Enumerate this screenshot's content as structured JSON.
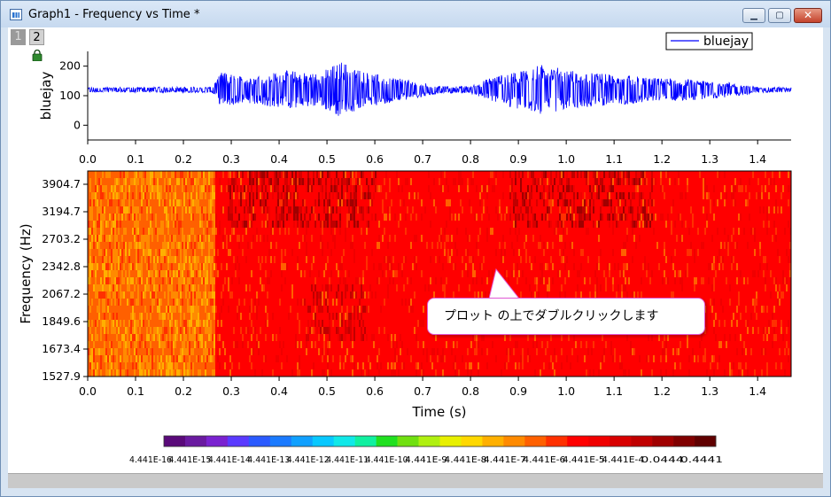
{
  "window": {
    "title": "Graph1 - Frequency vs Time *",
    "minimize_glyph": "▁",
    "maximize_glyph": "▢",
    "close_glyph": "✕"
  },
  "layers": [
    "1",
    "2"
  ],
  "legend": {
    "label": "bluejay",
    "color": "#0000ff"
  },
  "callout": {
    "text": "プロット の上でダブルクリックします"
  },
  "chart_data": [
    {
      "type": "line",
      "series": [
        {
          "name": "bluejay",
          "color": "#0000ff"
        }
      ],
      "ylabel": "bluejay",
      "xlabel": "",
      "x_ticks": [
        "0.0",
        "0.1",
        "0.2",
        "0.3",
        "0.4",
        "0.5",
        "0.6",
        "0.7",
        "0.8",
        "0.9",
        "1.0",
        "1.1",
        "1.2",
        "1.3",
        "1.4"
      ],
      "y_ticks": [
        "0",
        "100",
        "200"
      ],
      "xlim": [
        0,
        1.47
      ],
      "ylim": [
        -50,
        250
      ],
      "baseline": 120,
      "envelope": [
        {
          "x": 0.0,
          "amp": 8
        },
        {
          "x": 0.26,
          "amp": 10
        },
        {
          "x": 0.28,
          "amp": 60
        },
        {
          "x": 0.32,
          "amp": 45
        },
        {
          "x": 0.42,
          "amp": 65
        },
        {
          "x": 0.48,
          "amp": 55
        },
        {
          "x": 0.53,
          "amp": 95
        },
        {
          "x": 0.58,
          "amp": 60
        },
        {
          "x": 0.66,
          "amp": 35
        },
        {
          "x": 0.74,
          "amp": 12
        },
        {
          "x": 0.8,
          "amp": 12
        },
        {
          "x": 0.84,
          "amp": 40
        },
        {
          "x": 0.95,
          "amp": 85
        },
        {
          "x": 1.03,
          "amp": 60
        },
        {
          "x": 1.12,
          "amp": 50
        },
        {
          "x": 1.18,
          "amp": 40
        },
        {
          "x": 1.26,
          "amp": 35
        },
        {
          "x": 1.34,
          "amp": 25
        },
        {
          "x": 1.4,
          "amp": 10
        },
        {
          "x": 1.47,
          "amp": 8
        }
      ]
    },
    {
      "type": "heatmap",
      "xlabel": "Time (s)",
      "ylabel": "Frequency (Hz)",
      "x_ticks": [
        "0.0",
        "0.1",
        "0.2",
        "0.3",
        "0.4",
        "0.5",
        "0.6",
        "0.7",
        "0.8",
        "0.9",
        "1.0",
        "1.1",
        "1.2",
        "1.3",
        "1.4"
      ],
      "y_ticks": [
        "3904.7",
        "3194.7",
        "2703.2",
        "2342.8",
        "2067.2",
        "1849.6",
        "1673.4",
        "1527.9"
      ],
      "xlim": [
        0,
        1.47
      ],
      "colorscale": {
        "colors": [
          "#5a0a7a",
          "#6a1aa0",
          "#7a22d0",
          "#5a3aff",
          "#2a5aff",
          "#1a7aff",
          "#10a0ff",
          "#08c8ff",
          "#10e8e8",
          "#10f0a0",
          "#20e020",
          "#70e010",
          "#b0f010",
          "#e8f000",
          "#ffd800",
          "#ffb000",
          "#ff8a00",
          "#ff6000",
          "#ff3000",
          "#ff0000",
          "#f00000",
          "#d80000",
          "#c00000",
          "#a00000",
          "#800000",
          "#600000"
        ],
        "labels": [
          "4.441E-16",
          "4.441E-15",
          "4.441E-14",
          "4.441E-13",
          "4.441E-12",
          "4.441E-11",
          "4.441E-10",
          "4.441E-9",
          "4.441E-8",
          "4.441E-7",
          "4.441E-6",
          "4.441E-5",
          "4.441E-4",
          "0.0444",
          "0.4441"
        ]
      }
    }
  ]
}
